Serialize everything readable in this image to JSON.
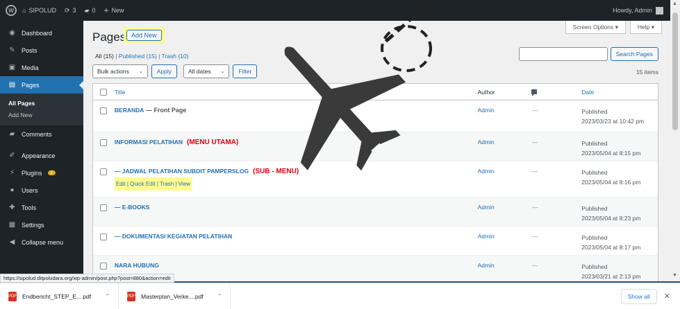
{
  "adminbar": {
    "site_name": "SIPOLUD",
    "updates_count": "3",
    "comments_count": "0",
    "new_label": "New",
    "howdy": "Howdy, Admin"
  },
  "sidebar": {
    "items": [
      {
        "label": "Dashboard",
        "icon": "dashboard-icon"
      },
      {
        "label": "Posts",
        "icon": "pin-icon"
      },
      {
        "label": "Media",
        "icon": "media-icon"
      },
      {
        "label": "Pages",
        "icon": "page-icon"
      },
      {
        "label": "Comments",
        "icon": "comment-icon"
      },
      {
        "label": "Appearance",
        "icon": "brush-icon"
      },
      {
        "label": "Plugins",
        "icon": "plugin-icon",
        "badge": "2"
      },
      {
        "label": "Users",
        "icon": "users-icon"
      },
      {
        "label": "Tools",
        "icon": "wrench-icon"
      },
      {
        "label": "Settings",
        "icon": "settings-icon"
      },
      {
        "label": "Collapse menu",
        "icon": "collapse-icon"
      }
    ],
    "submenu": [
      "All Pages",
      "Add New"
    ]
  },
  "header": {
    "title": "Pages",
    "add_new": "Add New",
    "screen_options": "Screen Options ▾",
    "help": "Help ▾"
  },
  "views": {
    "all": "All",
    "all_count": "(15)",
    "published": "Published",
    "published_count": "(15)",
    "trash": "Trash",
    "trash_count": "(10)"
  },
  "search": {
    "button": "Search Pages",
    "value": ""
  },
  "tablenav": {
    "bulk_actions": "Bulk actions",
    "apply": "Apply",
    "all_dates": "All dates",
    "filter": "Filter",
    "items_count": "15 items"
  },
  "table": {
    "headers": {
      "title": "Title",
      "author": "Author",
      "date": "Date"
    },
    "rows": [
      {
        "title": "BERANDA",
        "state": " — Front Page",
        "author": "Admin",
        "comments": "—",
        "status": "Published",
        "date": "2023/03/23 at 10:42 pm",
        "note": ""
      },
      {
        "title": "INFORMASI PELATIHAN",
        "state": "",
        "author": "Admin",
        "comments": "—",
        "status": "Published",
        "date": "2023/05/04 at 8:15 pm",
        "note": "(MENU UTAMA)"
      },
      {
        "title": "— JADWAL PELATIHAN SUBDIT PAMPERSLOG",
        "state": "",
        "author": "Admin",
        "comments": "—",
        "status": "Published",
        "date": "2023/05/04 at 8:16 pm",
        "note": "(SUB - MENU)",
        "actions": "Edit | Quick Edit | Trash | View"
      },
      {
        "title": "— E-BOOKS",
        "state": "",
        "author": "Admin",
        "comments": "—",
        "status": "Published",
        "date": "2023/05/04 at 8:23 pm",
        "note": ""
      },
      {
        "title": "— DOKUMENTASI KEGIATAN PELATIHAN",
        "state": "",
        "author": "Admin",
        "comments": "—",
        "status": "Published",
        "date": "2023/05/04 at 8:17 pm",
        "note": ""
      },
      {
        "title": "NARA HUBUNG",
        "state": "",
        "author": "Admin",
        "comments": "—",
        "status": "Published",
        "date": "2023/03/21 at 2:13 pm",
        "note": ""
      }
    ]
  },
  "status_url": "https://sipolud.ditpoludara.org/wp-admin/post.php?post=880&action=edit",
  "downloads": {
    "files": [
      "Endbericht_STEP_E....pdf",
      "Masterplan_Verke....pdf"
    ],
    "show_all": "Show all"
  },
  "colors": {
    "accent": "#2271b1",
    "admin_dark": "#1d2327",
    "highlight": "#fffb8f",
    "annotation_red": "#e1000f"
  }
}
